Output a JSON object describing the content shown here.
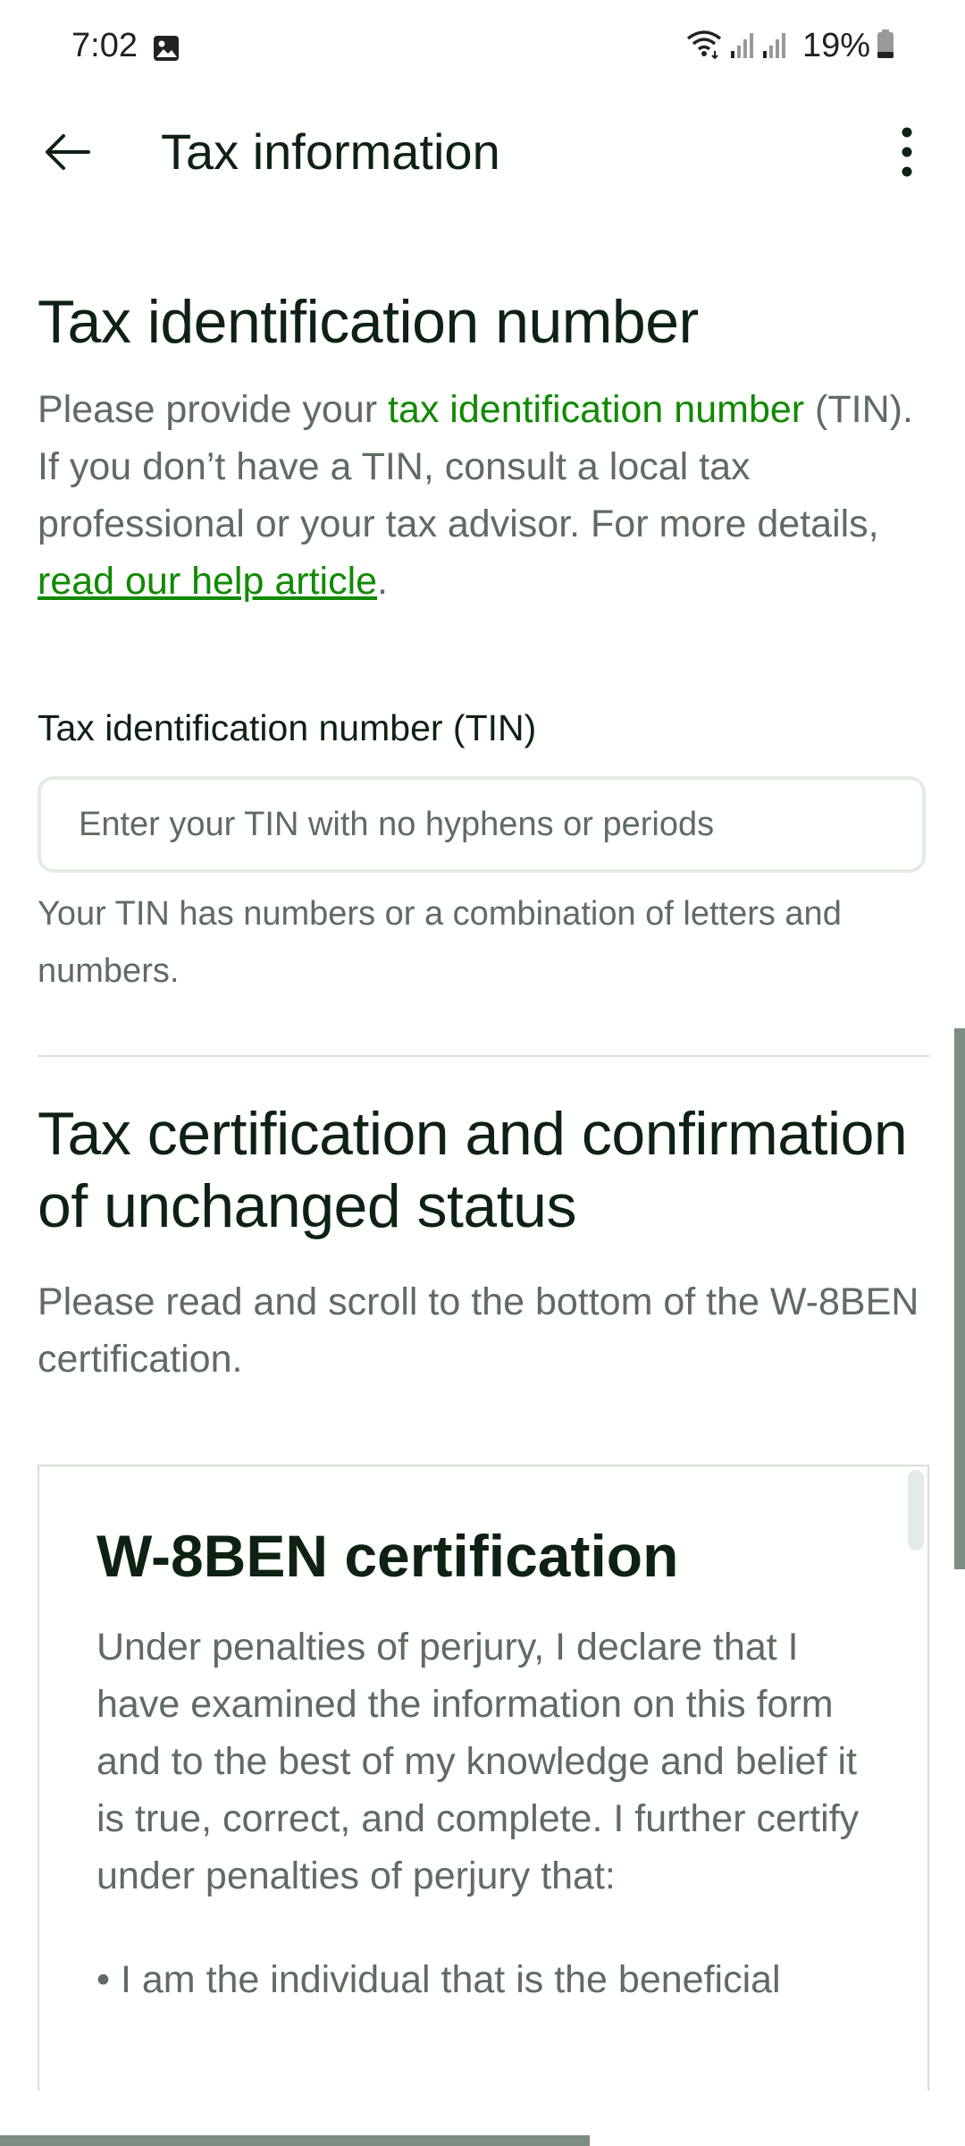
{
  "status_bar": {
    "time": "7:02",
    "battery": "19%",
    "icons": [
      "photo-icon",
      "wifi-icon",
      "signal-icon",
      "signal-icon",
      "battery-icon"
    ]
  },
  "app_bar": {
    "title": "Tax information",
    "back_icon": "arrow-left-icon",
    "menu_icon": "more-vert-icon"
  },
  "tin_section": {
    "heading": "Tax identification number",
    "intro_prefix": "Please provide your ",
    "intro_link": "tax identification number",
    "intro_middle": " (TIN). If you don’t have a TIN, consult a local tax professional or your tax advisor. For more details, ",
    "help_link": "read our help article",
    "intro_suffix": ".",
    "field_label": "Tax identification number (TIN)",
    "input_value": "",
    "input_placeholder": "Enter your TIN with no hyphens or periods",
    "helper_text": "Your TIN has numbers or a combination of letters and numbers."
  },
  "certification_section": {
    "heading": "Tax certification and confirmation of unchanged status",
    "description": "Please read and scroll to the bottom of the W-8BEN certification.",
    "box": {
      "title": "W-8BEN certification",
      "body": "Under penalties of perjury, I declare that I have examined the information on this form and to the best of my knowledge and belief it is true, correct, and complete. I further certify under penalties of perjury that:",
      "bullet_1": "• I am the individual that is the beneficial"
    }
  },
  "colors": {
    "heading": "#0d2213",
    "body_text": "#5f6b63",
    "link_green": "#108a00",
    "border": "#d5e0d5",
    "scrollbar": "#7d8d81"
  }
}
